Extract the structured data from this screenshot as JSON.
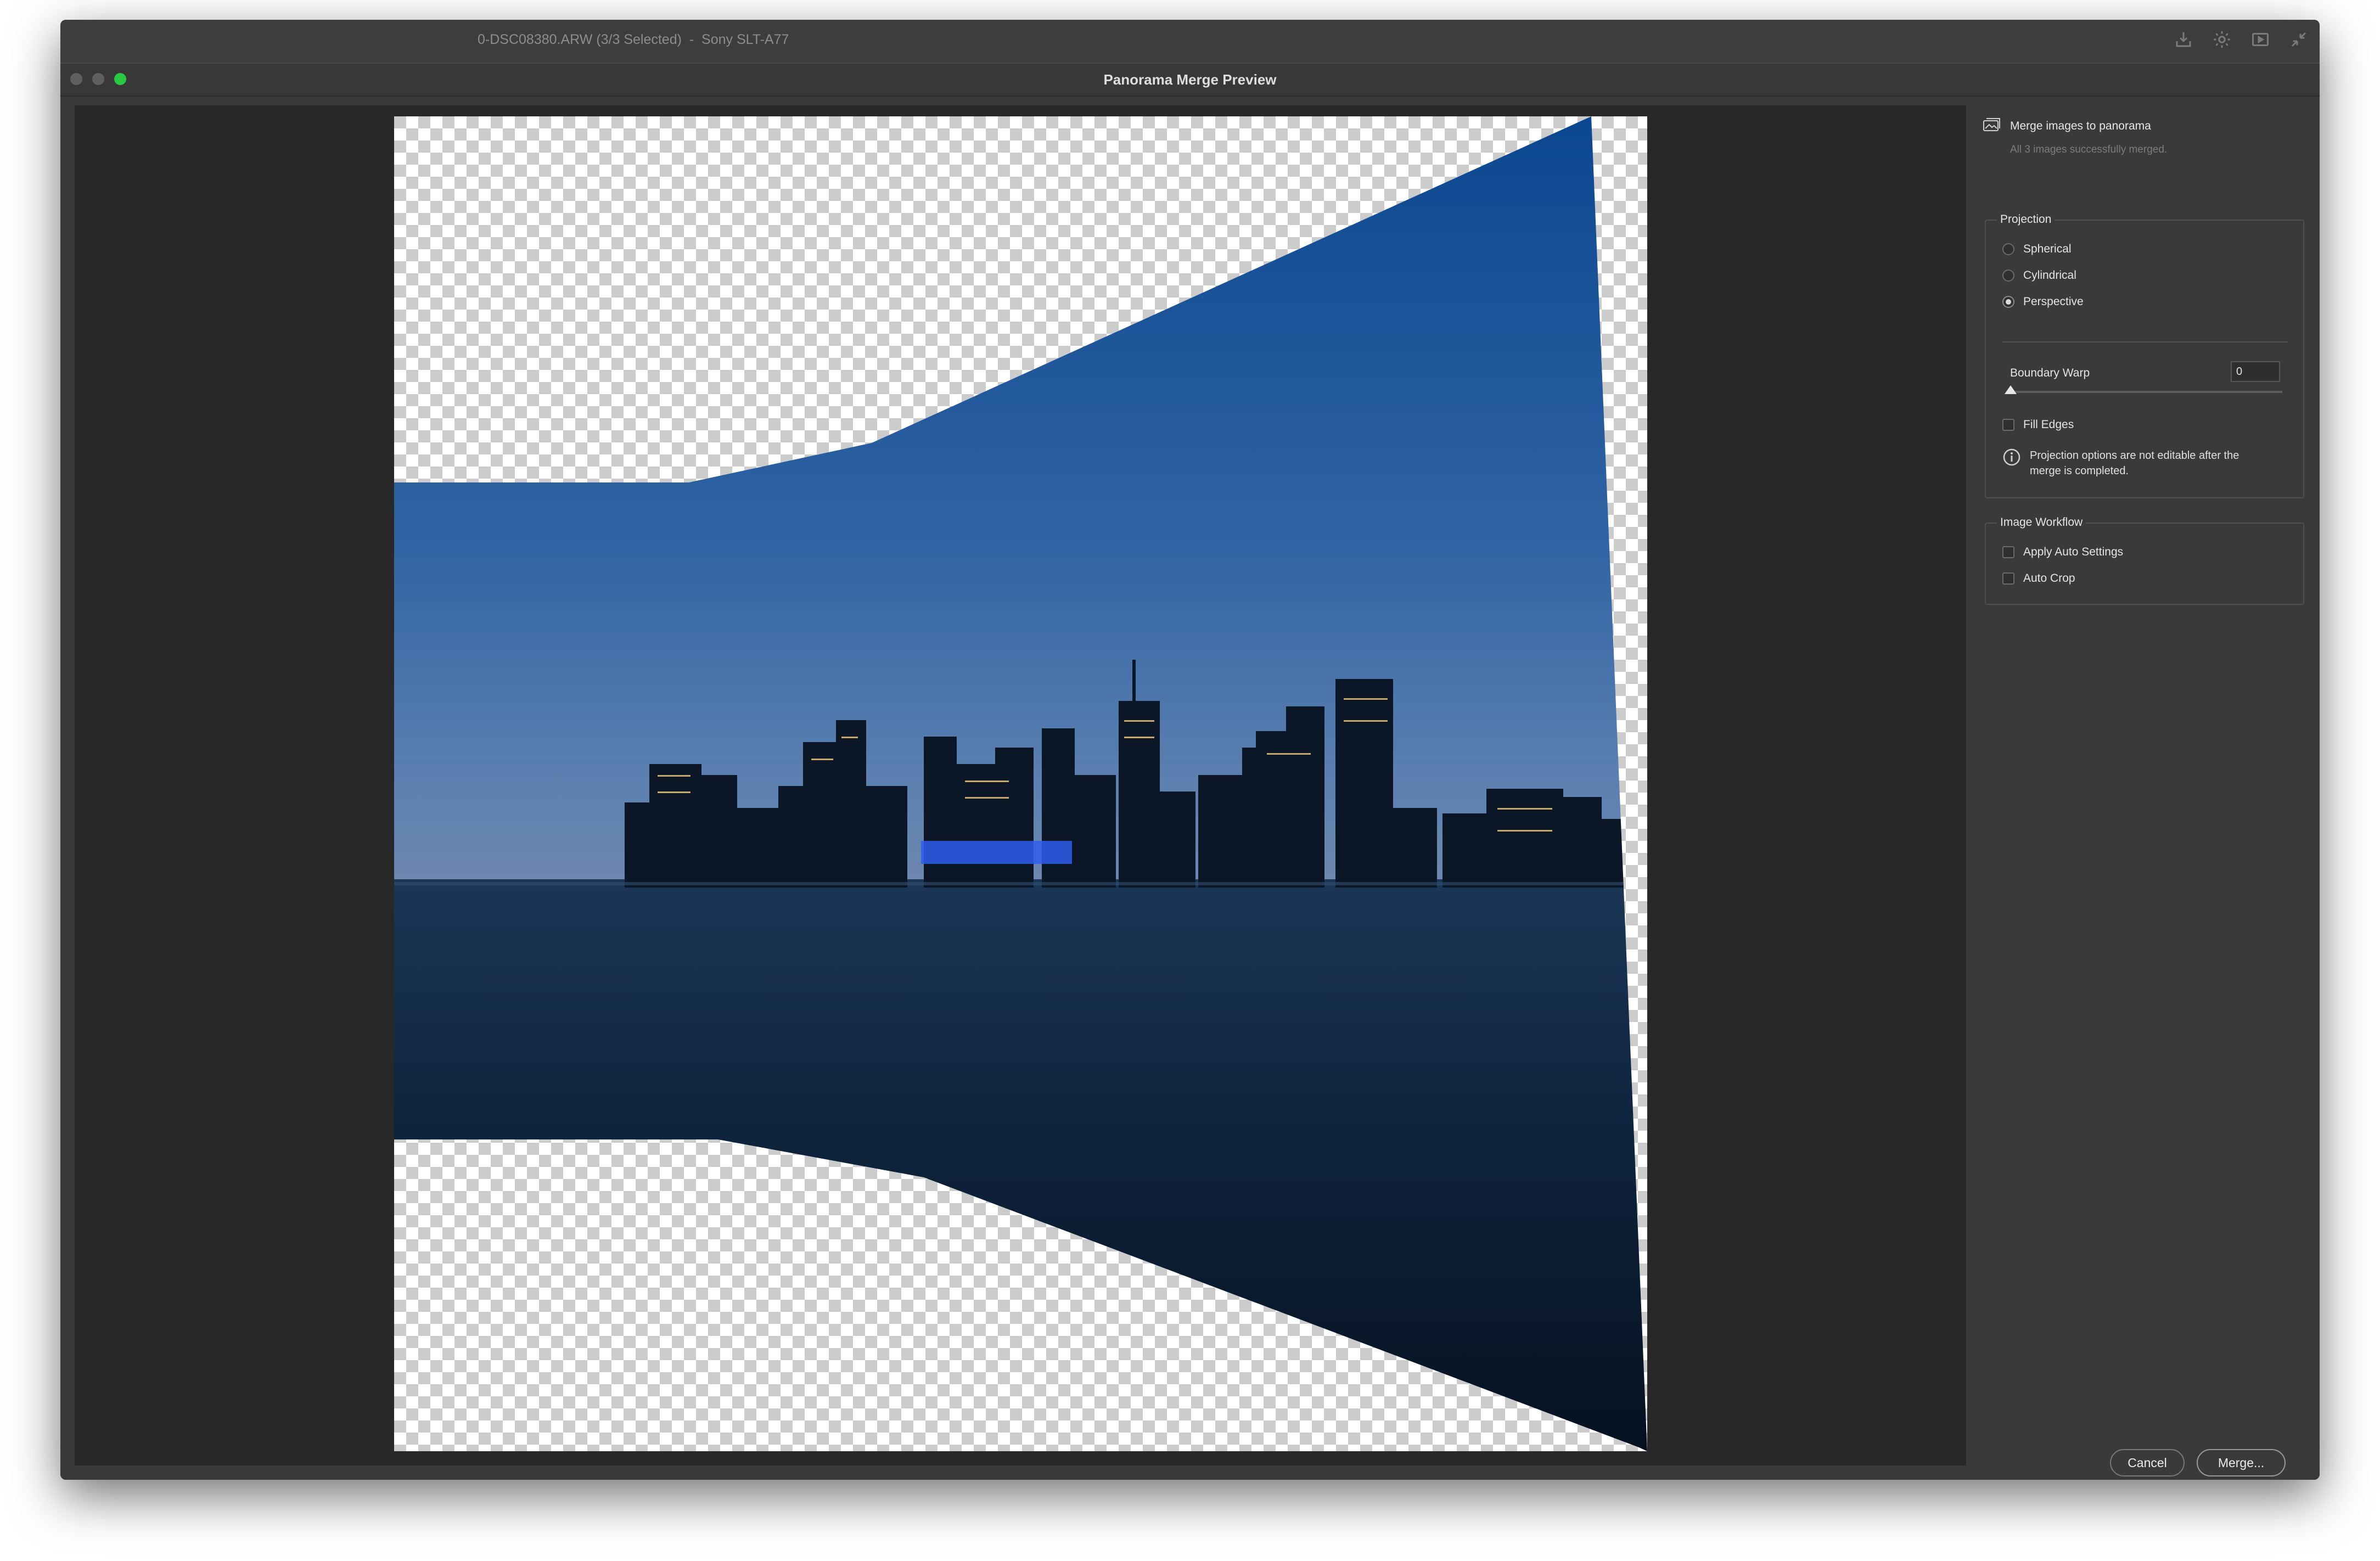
{
  "background_window": {
    "title": "0-DSC08380.ARW (3/3 Selected)  -  Sony SLT-A77",
    "icons": [
      "import-icon",
      "gear-icon",
      "slideshow-icon",
      "collapse-icon"
    ]
  },
  "dialog": {
    "title": "Panorama Merge Preview",
    "window_controls": {
      "close": "#ff5f57",
      "minimize": "#7f7f7f",
      "zoom": "#28c840"
    }
  },
  "panel": {
    "merge_title": "Merge images to panorama",
    "merge_subtitle": "All 3 images successfully merged.",
    "projection": {
      "legend": "Projection",
      "options": [
        {
          "label": "Spherical",
          "checked": false
        },
        {
          "label": "Cylindrical",
          "checked": false
        },
        {
          "label": "Perspective",
          "checked": true
        }
      ],
      "boundary_warp_label": "Boundary Warp",
      "boundary_warp_value": "0",
      "boundary_warp_level": 0,
      "fill_edges_label": "Fill Edges",
      "fill_edges_checked": false,
      "info_line1": "Projection options are not editable after the",
      "info_line2": "merge is completed."
    },
    "workflow": {
      "legend": "Image Workflow",
      "apply_auto_settings_label": "Apply Auto Settings",
      "apply_auto_settings_checked": false,
      "auto_crop_label": "Auto Crop",
      "auto_crop_checked": false
    }
  },
  "buttons": {
    "cancel": "Cancel",
    "merge": "Merge..."
  },
  "colors": {
    "window_bg": "#3a3a3a",
    "preview_bg": "#282828",
    "sky_top": "#0f4f93",
    "sky_bottom": "#4d7db3",
    "water": "#0c1e33"
  }
}
